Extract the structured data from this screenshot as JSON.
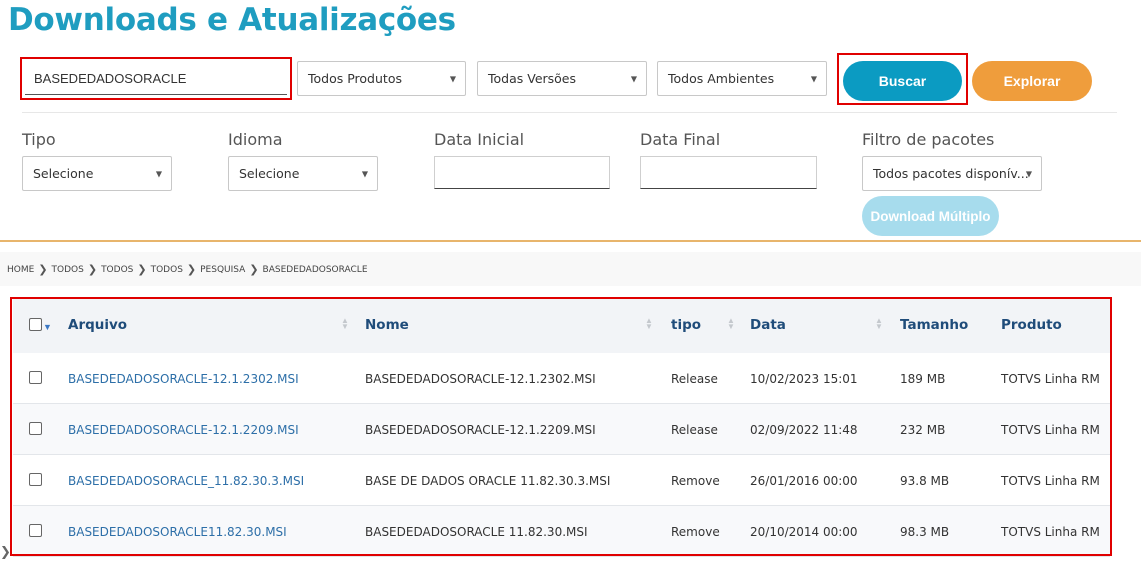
{
  "page": {
    "title": "Downloads e Atualizações"
  },
  "search": {
    "value": "BASEDEDADOSORACLE"
  },
  "selects": {
    "produtos": "Todos Produtos",
    "versoes": "Todas Versões",
    "ambientes": "Todos Ambientes"
  },
  "buttons": {
    "buscar": "Buscar",
    "explorar": "Explorar",
    "download_multiplo": "Download Múltiplo"
  },
  "filters": {
    "tipo_label": "Tipo",
    "tipo_value": "Selecione",
    "idioma_label": "Idioma",
    "idioma_value": "Selecione",
    "data_inicial_label": "Data Inicial",
    "data_final_label": "Data Final",
    "filtro_pacotes_label": "Filtro de pacotes",
    "filtro_pacotes_value": "Todos pacotes disponív..."
  },
  "breadcrumb": [
    "HOME",
    "TODOS",
    "TODOS",
    "TODOS",
    "PESQUISA",
    "BASEDEDADOSORACLE"
  ],
  "table": {
    "headers": {
      "arquivo": "Arquivo",
      "nome": "Nome",
      "tipo": "tipo",
      "data": "Data",
      "tamanho": "Tamanho",
      "produto": "Produto"
    },
    "rows": [
      {
        "arquivo": "BASEDEDADOSORACLE-12.1.2302.MSI",
        "nome": "BASEDEDADOSORACLE-12.1.2302.MSI",
        "tipo": "Release",
        "data": "10/02/2023 15:01",
        "tamanho": "189 MB",
        "produto": "TOTVS Linha RM"
      },
      {
        "arquivo": "BASEDEDADOSORACLE-12.1.2209.MSI",
        "nome": "BASEDEDADOSORACLE-12.1.2209.MSI",
        "tipo": "Release",
        "data": "02/09/2022 11:48",
        "tamanho": "232 MB",
        "produto": "TOTVS Linha RM"
      },
      {
        "arquivo": "BASEDEDADOSORACLE_11.82.30.3.MSI",
        "nome": "BASE DE DADOS ORACLE 11.82.30.3.MSI",
        "tipo": "Remove",
        "data": "26/01/2016 00:00",
        "tamanho": "93.8 MB",
        "produto": "TOTVS Linha RM"
      },
      {
        "arquivo": "BASEDEDADOSORACLE11.82.30.MSI",
        "nome": "BASEDEDADOSORACLE 11.82.30.MSI",
        "tipo": "Remove",
        "data": "20/10/2014 00:00",
        "tamanho": "98.3 MB",
        "produto": "TOTVS Linha RM"
      }
    ]
  },
  "colors": {
    "title": "#1f9dc0",
    "buscar": "#0b9bc2",
    "explorar": "#ef9d3c",
    "download": "#a7dced",
    "highlight": "#e00000"
  }
}
